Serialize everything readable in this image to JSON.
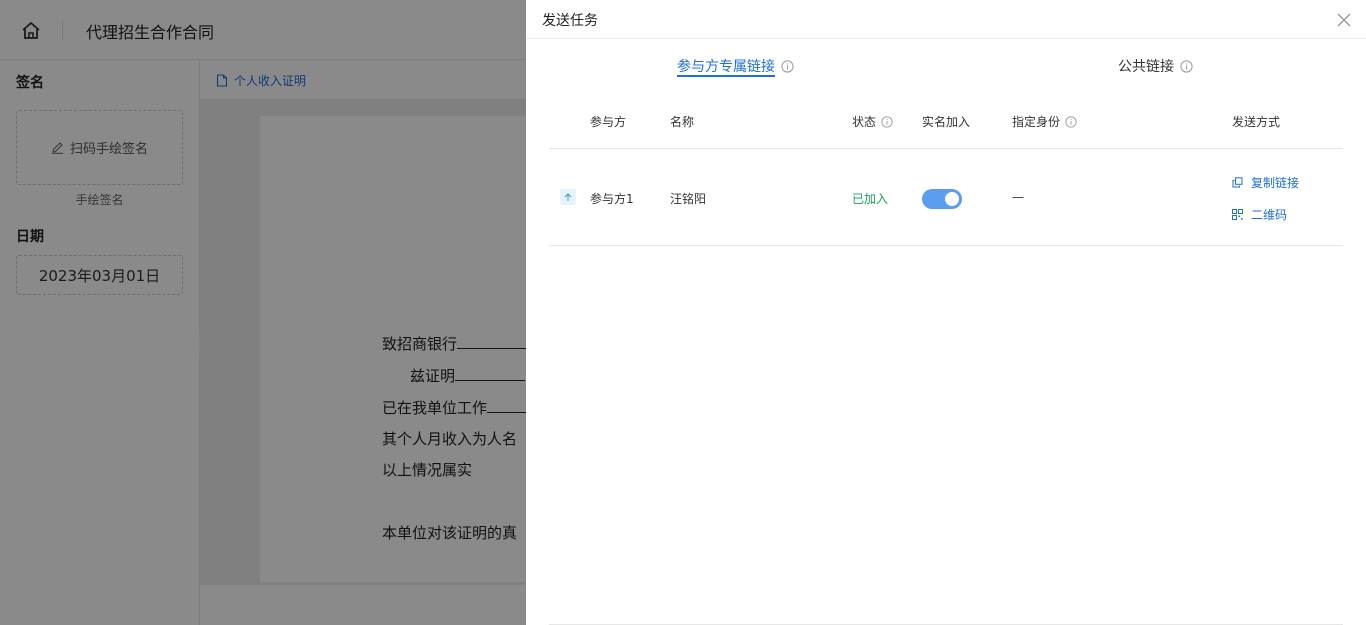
{
  "app": {
    "title": "代理招生合作合同",
    "file_tab": "个人收入证明"
  },
  "left_panel": {
    "signature_section": "签名",
    "signature_button": "扫码手绘签名",
    "signature_caption": "手绘签名",
    "date_section": "日期",
    "date_value": "2023年03月01日"
  },
  "document": {
    "lines": [
      "致招商银行",
      "兹证明",
      "已在我单位工作",
      "其个人月收入为人名",
      "以上情况属实",
      "本单位对该证明的真"
    ]
  },
  "drawer": {
    "title": "发送任务",
    "tabs": [
      {
        "label": "参与方专属链接"
      },
      {
        "label": "公共链接"
      }
    ],
    "columns": {
      "party": "参与方",
      "name": "名称",
      "status": "状态",
      "real_name": "实名加入",
      "identity": "指定身份",
      "send_method": "发送方式"
    },
    "rows": [
      {
        "party": "参与方1",
        "name": "汪铭阳",
        "status": "已加入",
        "real_name_enabled": true,
        "identity": "—",
        "copy_link": "复制链接",
        "qr_code": "二维码"
      }
    ]
  },
  "colors": {
    "accent": "#1e6fd9",
    "joined": "#19a35e",
    "toggle_on": "#5b9ef0"
  }
}
